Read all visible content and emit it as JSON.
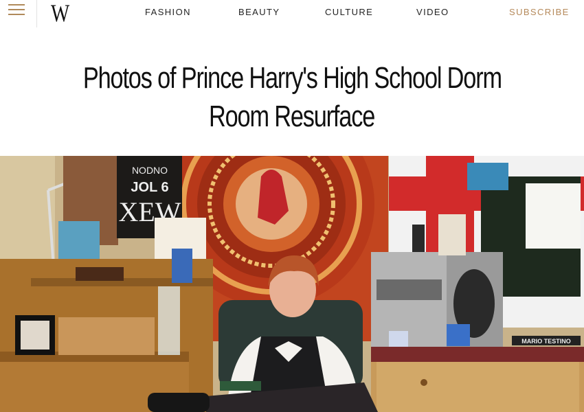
{
  "header": {
    "logo": "W",
    "nav": [
      "FASHION",
      "BEAUTY",
      "CULTURE",
      "VIDEO"
    ],
    "subscribe": "SUBSCRIBE",
    "accent_color": "#b5895a"
  },
  "article": {
    "title_line1": "Photos of Prince Harry's High School Dorm",
    "title_line2": "Room Resurface"
  },
  "photo": {
    "poster_text_1": "NODNO",
    "poster_text_2": "JOL 6",
    "poster_text_3": "XEW",
    "desk_label": "MARIO TESTINO"
  }
}
